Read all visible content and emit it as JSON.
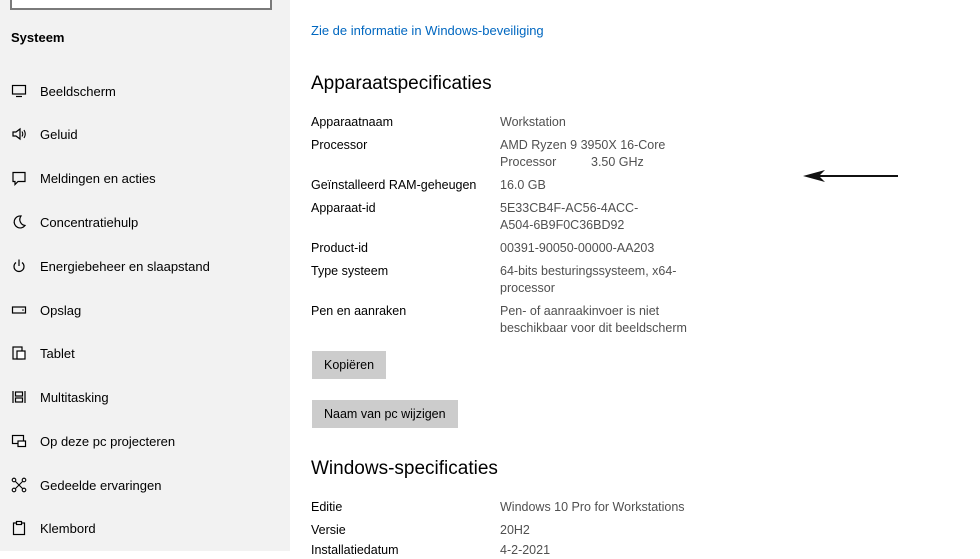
{
  "sidebar": {
    "title": "Systeem",
    "items": [
      {
        "label": "Beeldscherm",
        "icon": "monitor-icon"
      },
      {
        "label": "Geluid",
        "icon": "speaker-icon"
      },
      {
        "label": "Meldingen en acties",
        "icon": "notification-icon"
      },
      {
        "label": "Concentratiehulp",
        "icon": "moon-icon"
      },
      {
        "label": "Energiebeheer en slaapstand",
        "icon": "power-icon"
      },
      {
        "label": "Opslag",
        "icon": "storage-icon"
      },
      {
        "label": "Tablet",
        "icon": "tablet-icon"
      },
      {
        "label": "Multitasking",
        "icon": "multitasking-icon"
      },
      {
        "label": "Op deze pc projecteren",
        "icon": "project-icon"
      },
      {
        "label": "Gedeelde ervaringen",
        "icon": "shared-icon"
      },
      {
        "label": "Klembord",
        "icon": "clipboard-icon"
      }
    ]
  },
  "main": {
    "security_link": "Zie de informatie in Windows-beveiliging",
    "device_specs": {
      "heading": "Apparaatspecificaties",
      "rows": [
        {
          "label": "Apparaatnaam",
          "value": "Workstation"
        },
        {
          "label": "Processor",
          "value": "AMD Ryzen 9 3950X 16-Core\nProcessor          3.50 GHz"
        },
        {
          "label": "Geïnstalleerd RAM-geheugen",
          "value": "16.0 GB"
        },
        {
          "label": "Apparaat-id",
          "value": "5E33CB4F-AC56-4ACC-\nA504-6B9F0C36BD92"
        },
        {
          "label": "Product-id",
          "value": "00391-90050-00000-AA203"
        },
        {
          "label": "Type systeem",
          "value": "64-bits besturingssysteem, x64-\nprocessor"
        },
        {
          "label": "Pen en aanraken",
          "value": "Pen- of aanraakinvoer is niet\nbeschikbaar voor dit beeldscherm"
        }
      ],
      "copy_button": "Kopiëren",
      "rename_button": "Naam van pc wijzigen"
    },
    "windows_specs": {
      "heading": "Windows-specificaties",
      "rows": [
        {
          "label": "Editie",
          "value": "Windows 10 Pro for Workstations"
        },
        {
          "label": "Versie",
          "value": "20H2"
        },
        {
          "label": "Installatiedatum",
          "value": "4-2-2021"
        }
      ]
    }
  }
}
